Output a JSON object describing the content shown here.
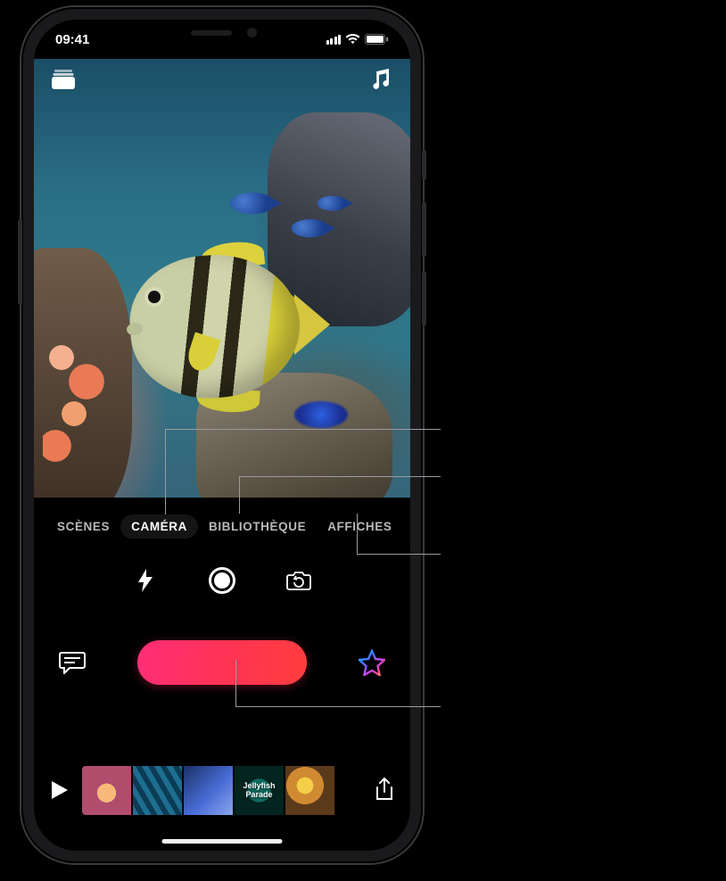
{
  "status": {
    "time": "09:41"
  },
  "top_icons": {
    "projects": "projects-icon",
    "music": "music-icon"
  },
  "tabs": {
    "items": [
      {
        "label": "SCÈNES",
        "active": false
      },
      {
        "label": "CAMÉRA",
        "active": true
      },
      {
        "label": "BIBLIOTHÈQUE",
        "active": false
      },
      {
        "label": "AFFICHES",
        "active": false
      }
    ]
  },
  "camera_controls": {
    "flash": "flash-icon",
    "shutter": "shutter-button",
    "flip": "camera-flip-icon"
  },
  "mid_row": {
    "captions": "live-titles-icon",
    "record": "record-hold-button",
    "effects": "effects-star-icon"
  },
  "bottom": {
    "play": "play-icon",
    "share": "share-icon",
    "clips": [
      {
        "label": ""
      },
      {
        "label": ""
      },
      {
        "label": ""
      },
      {
        "label": "Jellyfish Parade"
      },
      {
        "label": ""
      }
    ]
  }
}
